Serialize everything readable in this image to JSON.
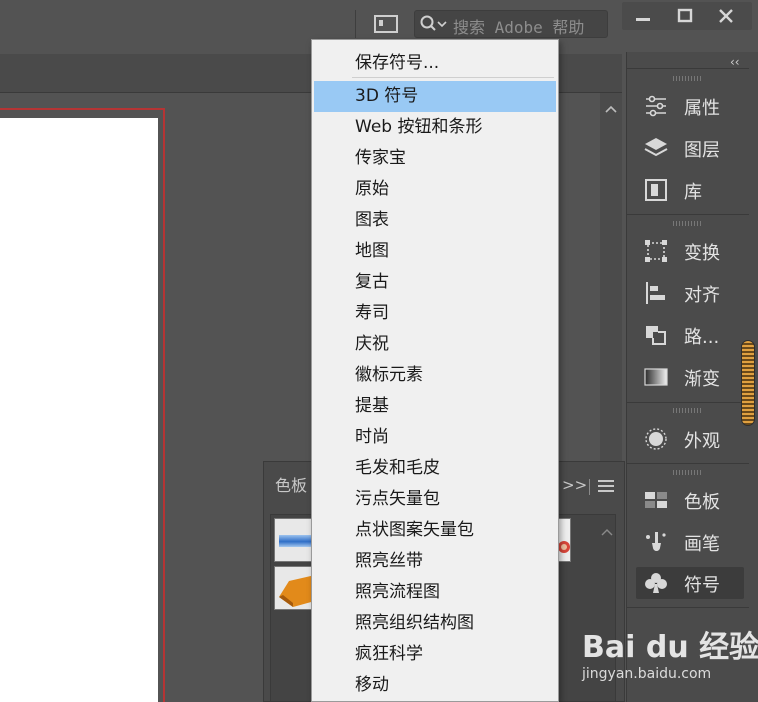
{
  "search": {
    "placeholder": "搜索 Adobe 帮助"
  },
  "window_controls": {
    "minimize": "minimize-icon",
    "maximize": "maximize-icon",
    "close": "close-icon"
  },
  "dock": {
    "collapse_label": "‹‹",
    "groups": [
      [
        {
          "label": "属性",
          "icon": "sliders-icon"
        },
        {
          "label": "图层",
          "icon": "layers-icon"
        },
        {
          "label": "库",
          "icon": "library-icon"
        }
      ],
      [
        {
          "label": "变换",
          "icon": "transform-icon"
        },
        {
          "label": "对齐",
          "icon": "align-icon"
        },
        {
          "label": "路...",
          "icon": "pathfinder-icon"
        },
        {
          "label": "渐变",
          "icon": "gradient-icon"
        }
      ],
      [
        {
          "label": "外观",
          "icon": "appearance-icon"
        }
      ],
      [
        {
          "label": "色板",
          "icon": "swatches-icon"
        },
        {
          "label": "画笔",
          "icon": "brush-icon"
        },
        {
          "label": "符号",
          "icon": "club-icon",
          "active": true
        }
      ]
    ]
  },
  "swatch_panel": {
    "tab_label": "色板",
    "more_label": ">>",
    "menu_icon": "hamburger-icon"
  },
  "menu": {
    "save_label": "保存符号...",
    "items": [
      "3D 符号",
      "Web 按钮和条形",
      "传家宝",
      "原始",
      "图表",
      "地图",
      "复古",
      "寿司",
      "庆祝",
      "徽标元素",
      "提基",
      "时尚",
      "毛发和毛皮",
      "污点矢量包",
      "点状图案矢量包",
      "照亮丝带",
      "照亮流程图",
      "照亮组织结构图",
      "疯狂科学",
      "移动"
    ],
    "selected_index": 0
  },
  "watermark": {
    "brand": "Bai du 经验",
    "url": "jingyan.baidu.com"
  },
  "colors": {
    "menu_highlight": "#99c9f4",
    "bleed": "#b53434",
    "app_bg": "#535353"
  }
}
